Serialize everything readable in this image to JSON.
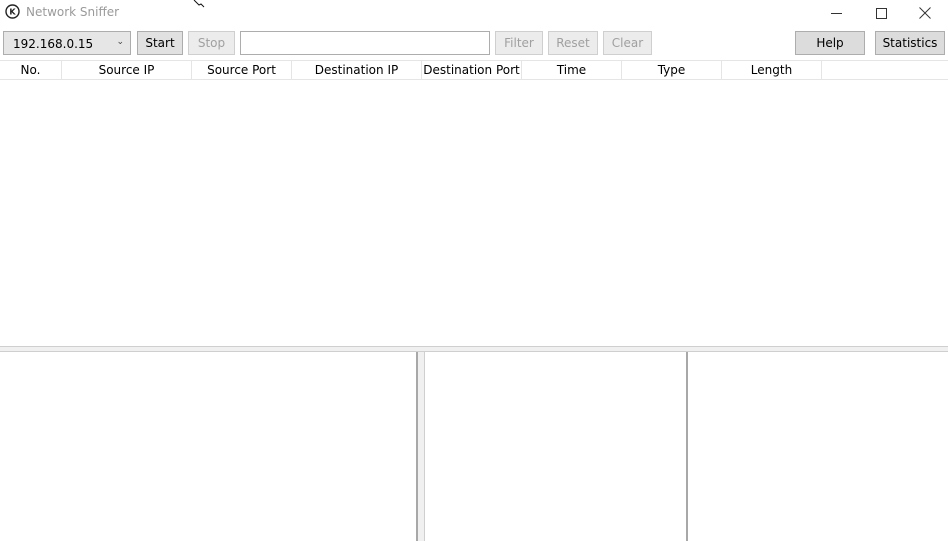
{
  "window": {
    "title": "Network Sniffer",
    "controls": {
      "minimize_icon": "minimize-icon",
      "maximize_icon": "maximize-icon",
      "close_icon": "close-icon"
    }
  },
  "toolbar": {
    "interface_select": {
      "value": "192.168.0.15"
    },
    "start_label": "Start",
    "stop_label": "Stop",
    "filter_input": {
      "value": "",
      "placeholder": ""
    },
    "filter_label": "Filter",
    "reset_label": "Reset",
    "clear_label": "Clear",
    "help_label": "Help",
    "statistics_label": "Statistics"
  },
  "packet_table": {
    "columns": [
      "No.",
      "Source IP",
      "Source Port",
      "Destination IP",
      "Destination Port",
      "Time",
      "Type",
      "Length"
    ],
    "rows": []
  },
  "colors": {
    "title_text": "#9a9a9a",
    "button_bg": "#e1e1e1",
    "button_border": "#adadad",
    "disabled_text": "#a0a0a0",
    "grid_line": "#e5e5e5"
  }
}
